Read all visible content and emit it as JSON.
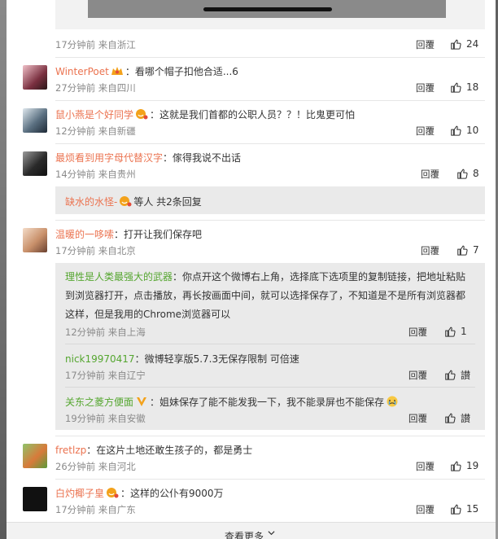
{
  "ui": {
    "reply_label": "回覆",
    "see_more_label": "查看更多"
  },
  "top_item": {
    "meta": "17分钟前 来自浙江",
    "likes": "24"
  },
  "comments": [
    {
      "user": "WinterPoet",
      "badge": "crown-badge",
      "text": "：看哪个帽子扣他合适...6",
      "meta": "27分钟前 来自四川",
      "likes": "18"
    },
    {
      "user": "鼠小燕是个好同学",
      "badge": "fan-badge",
      "text": "：这就是我们首都的公职人员？？！比鬼更可怕",
      "meta": "12分钟前 来自新疆",
      "likes": "10"
    },
    {
      "user": "最烦看到用字母代替汉字",
      "badge": "",
      "text": "：傢得我说不出话",
      "meta": "14分钟前 来自贵州",
      "likes": "8",
      "more_replies": {
        "user": "缺水的水怪-",
        "suffix": "等人 共2条回复"
      }
    },
    {
      "user": "温暖的一哆嗦",
      "badge": "",
      "text": "：打开让我们保存吧",
      "meta": "17分钟前 来自北京",
      "likes": "7"
    },
    {
      "user": "fretlzp",
      "badge": "",
      "text": "：在这片土地还敢生孩子的，都是勇士",
      "meta": "26分钟前 来自河北",
      "likes": "19"
    },
    {
      "user": "白灼椰子皇",
      "badge": "fan-badge",
      "text": "：这样的公仆有9000万",
      "meta": "17分钟前 来自广东",
      "likes": "15"
    }
  ],
  "replies": [
    {
      "user": "理性是人类最强大的武器",
      "text_lines": [
        "：你点开这个微博右上角，选择底下选项里的复制链接，把地址粘贴",
        "到浏览器打开，点击播放，再长按画面中间，就可以选择保存了，不知道是不是所有浏览器都",
        "这样，但是我用的Chrome浏览器可以"
      ],
      "meta": "12分钟前 来自上海",
      "likes": "1"
    },
    {
      "user": "nick19970417",
      "text": "：微博轻享版5.7.3无保存限制 可倍速",
      "meta": "17分钟前 来自辽宁",
      "likes": "讃"
    },
    {
      "user": "关东之菱方便面",
      "badge": "v-badge",
      "text": "：姐妹保存了能不能发我一下，我不能录屏也不能保存",
      "meta": "19分钟前 来自安徽",
      "likes": "讃"
    }
  ],
  "colors": {
    "username": "#eb7350",
    "reply_username": "#55a630",
    "meta": "#8a8a8a",
    "text": "#333333",
    "subbox_bg": "#eaeaea"
  }
}
